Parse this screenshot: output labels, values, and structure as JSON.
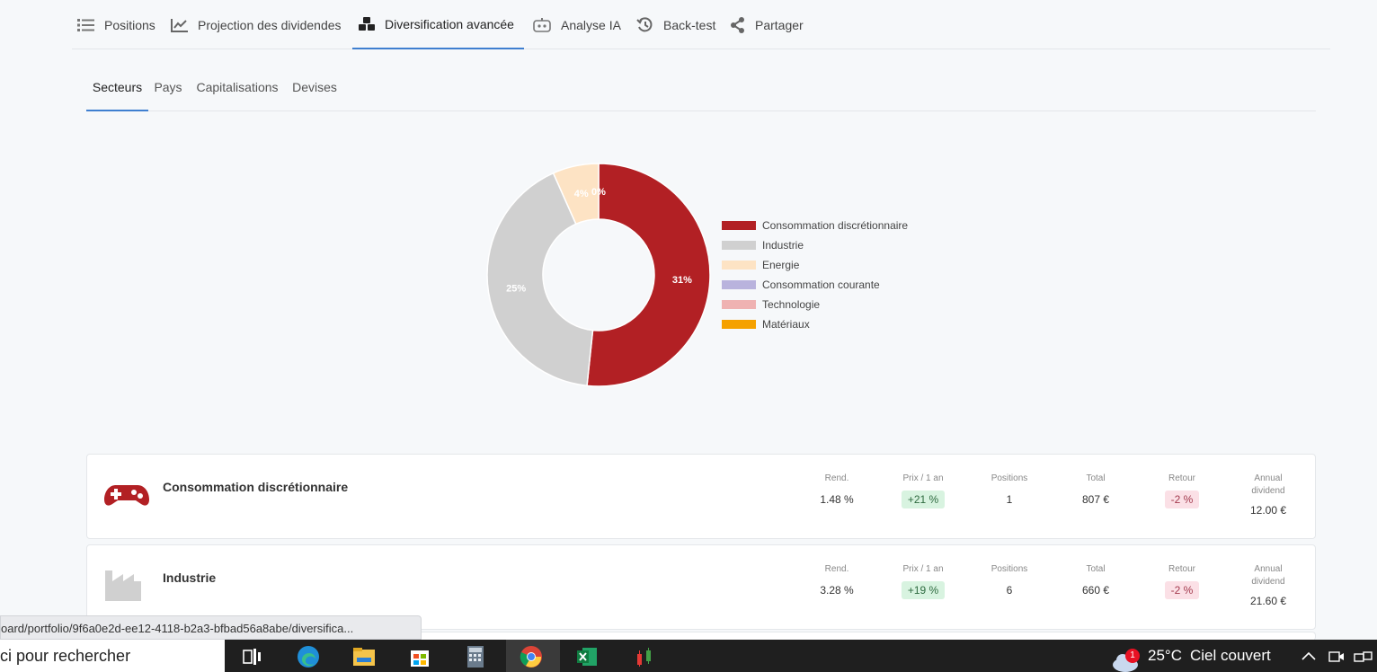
{
  "nav": {
    "items": [
      {
        "label": "Positions",
        "icon": "list-icon"
      },
      {
        "label": "Projection des dividendes",
        "icon": "chart-line-icon"
      },
      {
        "label": "Diversification avancée",
        "icon": "cubes-icon"
      },
      {
        "label": "Analyse IA",
        "icon": "robot-icon"
      },
      {
        "label": "Back-test",
        "icon": "history-icon"
      },
      {
        "label": "Partager",
        "icon": "share-icon"
      }
    ],
    "active": "Diversification avancée"
  },
  "subtabs": {
    "items": [
      "Secteurs",
      "Pays",
      "Capitalisations",
      "Devises"
    ],
    "active": "Secteurs"
  },
  "chart_data": {
    "type": "pie",
    "categories": [
      "Consommation discrétionnaire",
      "Industrie",
      "Energie",
      "Consommation courante",
      "Technologie",
      "Matériaux"
    ],
    "values": [
      31,
      25,
      4,
      0,
      0,
      0
    ],
    "data_labels": [
      "31%",
      "25%",
      "4%",
      "0%",
      "",
      ""
    ],
    "colors": [
      "#b22024",
      "#d0d0d0",
      "#fde3c4",
      "#b9b3dd",
      "#efb2b2",
      "#f5a100"
    ],
    "legend_position": "right"
  },
  "cards": [
    {
      "name": "Consommation discrétionnaire",
      "icon": "gamepad-icon",
      "rend_label": "Rend.",
      "rend": "1.48 %",
      "prix_label": "Prix / 1 an",
      "prix": "+21 %",
      "positions_label": "Positions",
      "positions": "1",
      "total_label": "Total",
      "total": "807 €",
      "retour_label": "Retour",
      "retour": "-2 %",
      "annual_label_1": "Annual",
      "annual_label_2": "dividend",
      "annual": "12.00 €"
    },
    {
      "name": "Industrie",
      "icon": "factory-icon",
      "rend_label": "Rend.",
      "rend": "3.28 %",
      "prix_label": "Prix / 1 an",
      "prix": "+19 %",
      "positions_label": "Positions",
      "positions": "6",
      "total_label": "Total",
      "total": "660 €",
      "retour_label": "Retour",
      "retour": "-2 %",
      "annual_label_1": "Annual",
      "annual_label_2": "dividend",
      "annual": "21.60 €"
    }
  ],
  "statusbar": {
    "url": "oard/portfolio/9f6a0e2d-ee12-4118-b2a3-bfbad56a8abe/diversifica..."
  },
  "taskbar": {
    "search_text": "ci pour rechercher",
    "weather_temp": "25°C",
    "weather_text": "Ciel couvert",
    "weather_badge": "1"
  }
}
